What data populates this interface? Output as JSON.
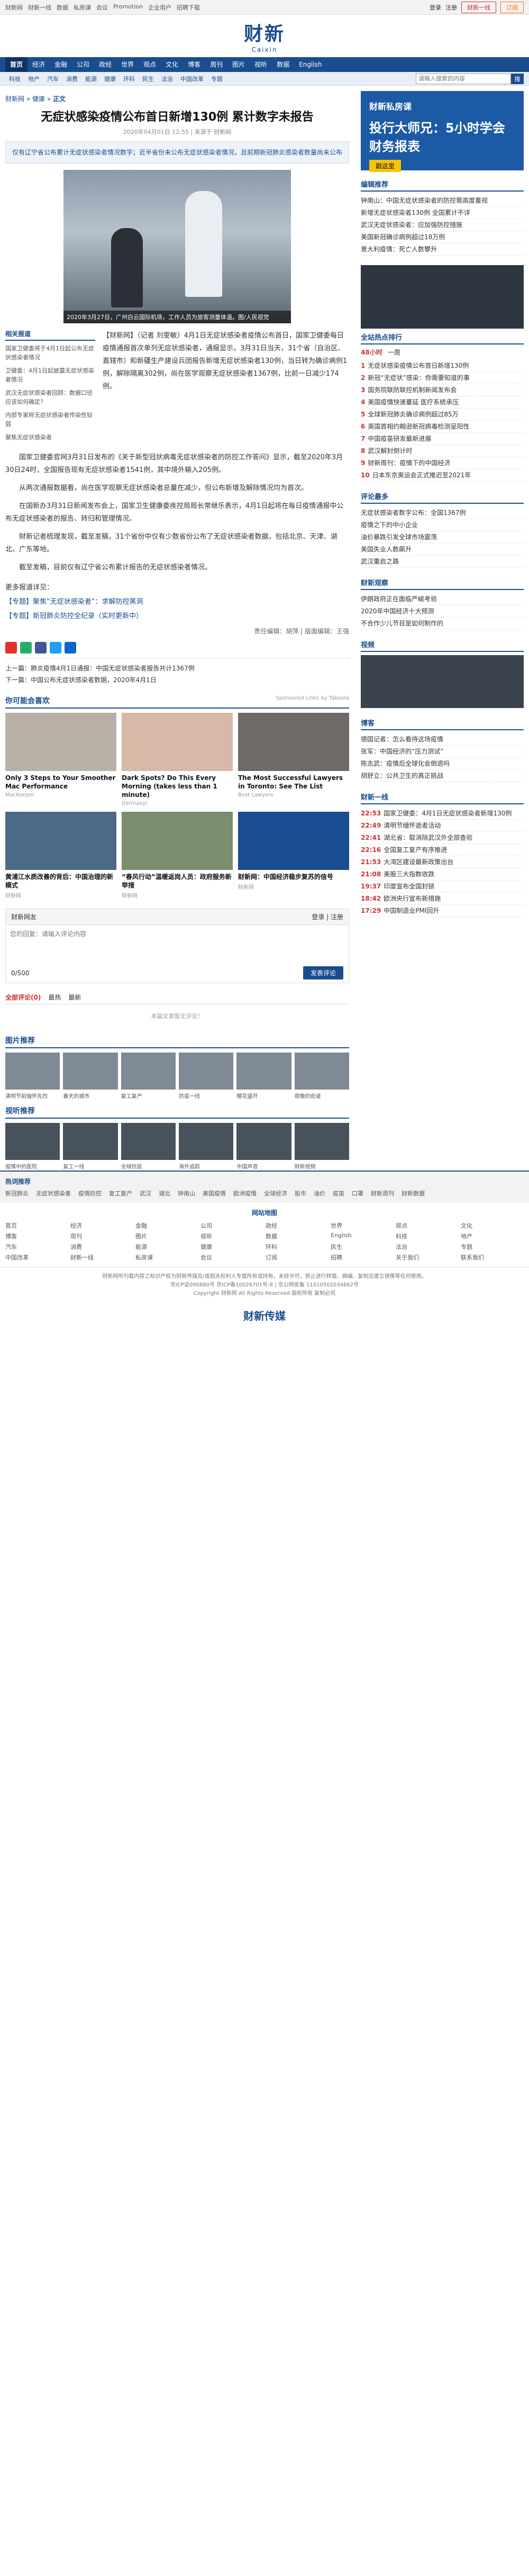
{
  "topbar": {
    "links": [
      "财新网",
      "财新一线",
      "数据",
      "私房课",
      "会议",
      "Promotion",
      "企业用户",
      "招聘下载"
    ],
    "login": "登录",
    "register": "注册",
    "btn1": "财新一线",
    "btn2": "订阅"
  },
  "logo": {
    "cn": "财新",
    "en": "Caixin"
  },
  "nav1": [
    "首页",
    "经济",
    "金融",
    "公司",
    "政经",
    "世界",
    "观点",
    "文化",
    "博客",
    "周刊",
    "图片",
    "视听",
    "数据",
    "English"
  ],
  "nav2": [
    "科技",
    "地产",
    "汽车",
    "消费",
    "能源",
    "健康",
    "环科",
    "民生",
    "法治",
    "中国改革",
    "专题"
  ],
  "search": {
    "placeholder": "请输入搜索的内容",
    "button": "搜"
  },
  "crumb": {
    "site": "财新网",
    "sep1": " » ",
    "channel": "健康",
    "sep2": " » ",
    "section": "正文"
  },
  "article": {
    "title": "无症状感染疫情公布首日新增130例 累计数字未报告",
    "meta": "2020年04月01日 12:55 | 来源于 财新网",
    "summary": "仅有辽宁省公布累计无症状感染者情况数字；近半省份未公布无症状感染者情况，且前期新冠肺炎感染者数量尚未公布",
    "caption": "2020年3月27日，广州白云国际机场，工作人员为旅客测量体温。图/人民视觉",
    "related_title": "相关报道",
    "related": [
      "国家卫健委将于4月1日起公布无症状感染者情况",
      "卫健委：4月1日起披露无症状感染者情况",
      "武汉无症状感染者回顾：数据口径应该如何确定？",
      "内部专家称无症状感染者传染性较弱",
      "聚焦无症状感染者"
    ],
    "lead": "【财新网】（记者 刘雯敏）4月1日无症状感染者疫情公布首日，国家卫健委每日疫情通报首次单列无症状感染者，通报显示，3月31日当天，31个省（自治区、直辖市）和新疆生产建设兵团报告新增无症状感染者130例，当日转为确诊病例1例，解除隔离302例，尚在医学观察无症状感染者1367例，比前一日减少174例。",
    "paragraphs": [
      "国家卫健委官网3月31日发布的《关于新型冠状病毒无症状感染者的防控工作答问》显示，截至2020年3月30日24时，全国报告现有无症状感染者1541例，其中境外输入205例。",
      "从两次通报数据看，尚在医学观察无症状感染者总量在减少，但公布新增及解除情况均为首次。",
      "在国新办3月31日新闻发布会上，国家卫生健康委疾控局局长常继乐表示，4月1日起将在每日疫情通报中公布无症状感染者的报告、转归和管理情况。",
      "财新记者梳理发现，截至发稿，31个省份中仅有少数省份公布了无症状感染者数据，包括北京、天津、湖北、广东等地。",
      "截至发稿，目前仅有辽宁省公布累计报告的无症状感染者情况。"
    ],
    "special_title": "更多报道详见：",
    "specials": [
      "【专题】聚焦“无症状感染者”：求解防控黑洞",
      "【专题】新冠肺炎防控全纪录（实时更新中）"
    ],
    "editor": "责任编辑：胡萍 | 版面编辑：王强",
    "prev": "上一篇：肺炎疫情4月1日通报：中国无症状感染者报告共计1367例",
    "next": "下一篇：中国公布无症状感染者数据，2020年4月1日"
  },
  "may_like": {
    "title": "你可能会喜欢",
    "sponsor": "Sponsored Links by Taboola",
    "cards": [
      {
        "title": "Only 3 Steps to Your Smoother Mac Performance",
        "source": "MacKeeper"
      },
      {
        "title": "Dark Spots? Do This Every Morning (takes less than 1 minute)",
        "source": "Dermaxyl"
      },
      {
        "title": "The Most Successful Lawyers in Toronto: See The List",
        "source": "Best Lawyers"
      },
      {
        "title": "黄浦江水质改善的背后：中国治理的新模式",
        "source": "财新网"
      },
      {
        "title": "“春风行动”温暖返岗人员：政府服务新举措",
        "source": "财新网"
      },
      {
        "title": "财新网：中国经济稳步复苏的信号",
        "source": "财新网"
      }
    ]
  },
  "comment": {
    "title": "财新网友",
    "login": "登录 | 注册",
    "placeholder": "您的回复：请输入评论内容",
    "count": "0/500",
    "post": "发表评论",
    "tabs": [
      "全部评论(0)",
      "最热",
      "最新"
    ],
    "empty": "本篇文章暂无评论！"
  },
  "gallery": {
    "title": "图片推荐",
    "items": [
      "清明节前缅怀先烈",
      "春天的城市",
      "复工复产",
      "防疫一线",
      "樱花盛开",
      "夜晚的街道"
    ]
  },
  "video": {
    "title": "视听推荐",
    "items": [
      "疫情中的医院",
      "复工一线",
      "全球抗疫",
      "海外追踪",
      "中国声音",
      "财新视频"
    ]
  },
  "sidebar": {
    "ad1_title": "财新私房课",
    "ad1_big": "投行大师兄：5小时学会财务报表",
    "ad1_btn": "戳这里",
    "hot_title": "编辑推荐",
    "hot": [
      "钟南山：中国无症状感染者的防控需高度重视",
      "新增无症状感染者130例 全国累计不详",
      "武汉无症状感染者：应加强防控措施",
      "美国新冠确诊病例超过18万例",
      "意大利疫情：死亡人数攀升"
    ],
    "rank_title": "全站热点排行",
    "rank_tabs": [
      "48小时",
      "一周"
    ],
    "rank": [
      "无症状感染疫情公布首日新增130例",
      "新冠“无症状”感染：你需要知道的事",
      "国务院联防联控机制新闻发布会",
      "美国疫情快速蔓延 医疗系统承压",
      "全球新冠肺炎确诊病例超过85万",
      "英国首相约翰逊新冠病毒检测呈阳性",
      "中国疫苗研发最新进展",
      "武汉解封倒计时",
      "财新周刊：疫情下的中国经济",
      "日本东京奥运会正式推迟至2021年"
    ],
    "comment_rank_title": "评论最多",
    "comment_rank": [
      "无症状感染者数字公布：全国1367例",
      "疫情之下的中小企业",
      "油价暴跌引发全球市场震荡",
      "美国失业人数飙升",
      "武汉重启之路"
    ],
    "expert_title": "财新观察",
    "experts": [
      "伊朗政府正在面临严峻考验",
      "2020年中国经济十大预测",
      "不合作少儿节目是如何制作的"
    ],
    "video_title": "视频",
    "blog_title": "博客",
    "blogs": [
      "德国记者：怎么看待这场疫情",
      "张军：中国经济的“压力测试”",
      "陈志武：疫情后全球化会倒退吗",
      "胡舒立：公共卫生的真正挑战"
    ],
    "live_title": "财新一线",
    "live": [
      {
        "time": "22:53",
        "text": "国家卫健委：4月1日无症状感染者新增130例"
      },
      {
        "time": "22:49",
        "text": "清明节缅怀逝者活动"
      },
      {
        "time": "22:41",
        "text": "湖北省：取消除武汉外全部查验"
      },
      {
        "time": "22:16",
        "text": "全国复工复产有序推进"
      },
      {
        "time": "21:53",
        "text": "大湾区建设最新政策出台"
      },
      {
        "time": "21:08",
        "text": "美股三大指数收跌"
      },
      {
        "time": "19:37",
        "text": "印度宣布全国封锁"
      },
      {
        "time": "18:42",
        "text": "欧洲央行宣布新措施"
      },
      {
        "time": "17:29",
        "text": "中国制造业PMI回升"
      }
    ]
  },
  "footer": {
    "links_title": "热词推荐",
    "links": [
      "新冠肺炎",
      "无症状感染者",
      "疫情防控",
      "复工复产",
      "武汉",
      "湖北",
      "钟南山",
      "美国疫情",
      "欧洲疫情",
      "全球经济",
      "股市",
      "油价",
      "疫苗",
      "口罩",
      "财新周刊",
      "财新数据"
    ],
    "sitemap_title": "网站地图",
    "sitemap": [
      "首页",
      "经济",
      "金融",
      "公司",
      "政经",
      "世界",
      "观点",
      "文化",
      "博客",
      "周刊",
      "图片",
      "视听",
      "数据",
      "English",
      "科技",
      "地产",
      "汽车",
      "消费",
      "能源",
      "健康",
      "环科",
      "民生",
      "法治",
      "专题",
      "中国改革",
      "财新一线",
      "私房课",
      "会议",
      "订阅",
      "招聘",
      "关于我们",
      "联系我们"
    ],
    "copyright": "财新网所刊载内容之知识产权为财新传媒及/或相关权利人专属所有或持有。未经许可，禁止进行转载、摘编、复制及建立镜像等任何使用。",
    "icp": "京ICP证090880号 京ICP备10026701号-8 | 京公网安备 11010502034662号",
    "copy": "Copyright 财新网 All Rights Reserved 版权所有 复制必究",
    "bottom_logo": "财新传媒"
  }
}
